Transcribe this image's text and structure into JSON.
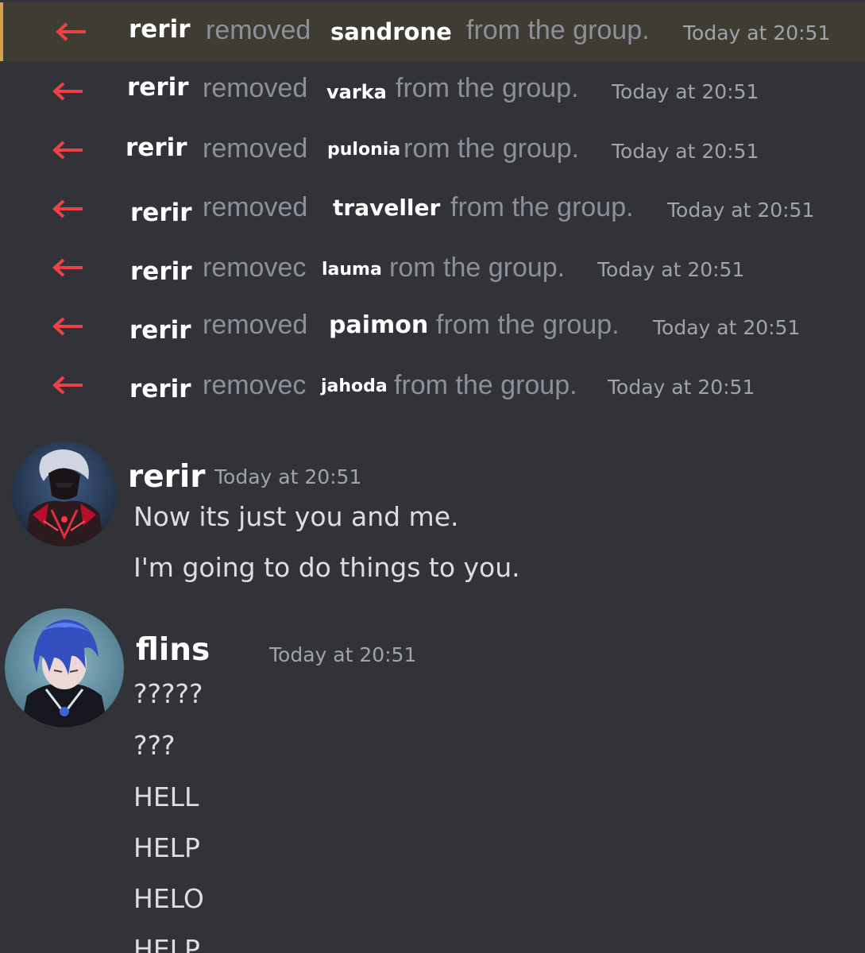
{
  "colors": {
    "background": "#313338",
    "highlight_background": "#3f3c34",
    "highlight_bar": "#d4a24c",
    "leave_arrow": "#ed4245",
    "system_text": "#8d9098",
    "timestamp": "#a0a3aa",
    "username": "#ffffff",
    "message_text": "#dcdee1"
  },
  "system_messages": [
    {
      "icon": "leave-arrow-icon",
      "actor": "rerir",
      "verb": "removed",
      "target": "sandrone",
      "tail": "from the group.",
      "timestamp": "Today at 20:51"
    },
    {
      "icon": "leave-arrow-icon",
      "actor": "rerir",
      "verb": "removed",
      "target": "varka",
      "tail": "from the group.",
      "timestamp": "Today at 20:51"
    },
    {
      "icon": "leave-arrow-icon",
      "actor": "rerir",
      "verb": "removed",
      "target": "pulonia",
      "tail": "rom the group.",
      "timestamp": "Today at 20:51"
    },
    {
      "icon": "leave-arrow-icon",
      "actor": "rerir",
      "verb": "removed",
      "target": "traveller",
      "tail": "from the group.",
      "timestamp": "Today at 20:51"
    },
    {
      "icon": "leave-arrow-icon",
      "actor": "rerir",
      "verb": "removec",
      "target": "lauma",
      "tail": "rom the group.",
      "timestamp": "Today at 20:51"
    },
    {
      "icon": "leave-arrow-icon",
      "actor": "rerir",
      "verb": "removed",
      "target": "paimon",
      "tail": "from the group.",
      "timestamp": "Today at 20:51"
    },
    {
      "icon": "leave-arrow-icon",
      "actor": "rerir",
      "verb": "removec",
      "target": "jahoda",
      "tail": "from the group.",
      "timestamp": "Today at 20:51"
    }
  ],
  "message_groups": [
    {
      "author": "rerir",
      "timestamp": "Today at 20:51",
      "avatar": "red-armored-character-avatar",
      "messages": [
        "Now its just you and me.",
        "I'm going to do things to you."
      ]
    },
    {
      "author": "flins",
      "timestamp": "Today at 20:51",
      "avatar": "blue-haired-character-avatar",
      "messages": [
        "?????",
        "???",
        "HELL",
        "HELP",
        "HELO",
        "HELP"
      ]
    }
  ]
}
